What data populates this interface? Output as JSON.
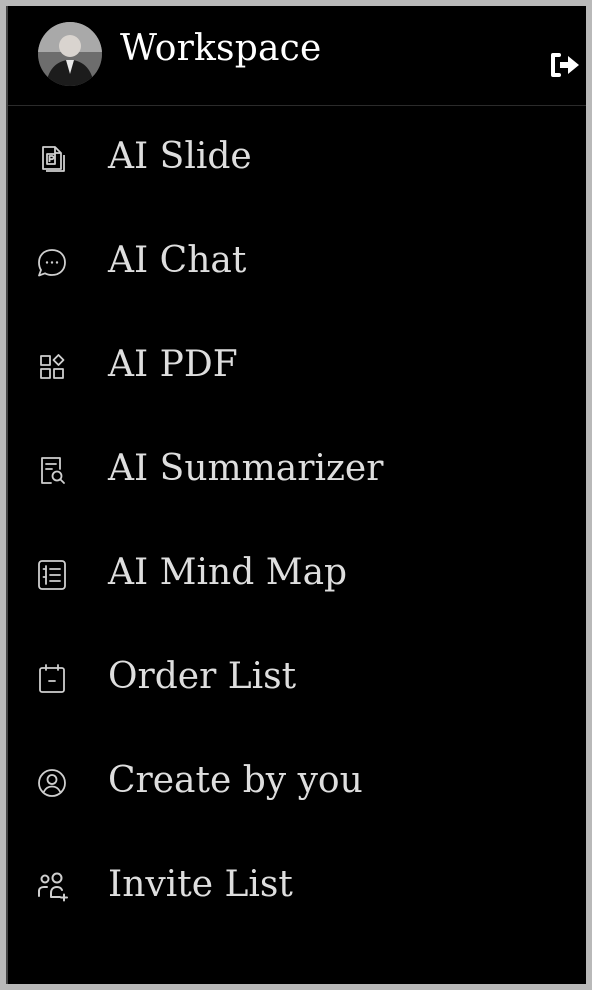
{
  "header": {
    "title": "Workspace",
    "avatar_icon": "user-avatar",
    "logout_icon": "logout-icon"
  },
  "nav": {
    "items": [
      {
        "label": "AI Slide",
        "icon": "slide-icon"
      },
      {
        "label": "AI Chat",
        "icon": "chat-bubble-icon"
      },
      {
        "label": "AI PDF",
        "icon": "grid-apps-icon"
      },
      {
        "label": "AI Summarizer",
        "icon": "document-search-icon"
      },
      {
        "label": "AI Mind Map",
        "icon": "list-outline-icon"
      },
      {
        "label": "Order List",
        "icon": "calendar-minus-icon"
      },
      {
        "label": "Create by you",
        "icon": "user-circle-icon"
      },
      {
        "label": "Invite List",
        "icon": "users-add-icon"
      }
    ]
  },
  "colors": {
    "background": "#000000",
    "text": "#dedede",
    "icon_stroke": "#cfcfcf",
    "frame": "#b9b9b9"
  }
}
